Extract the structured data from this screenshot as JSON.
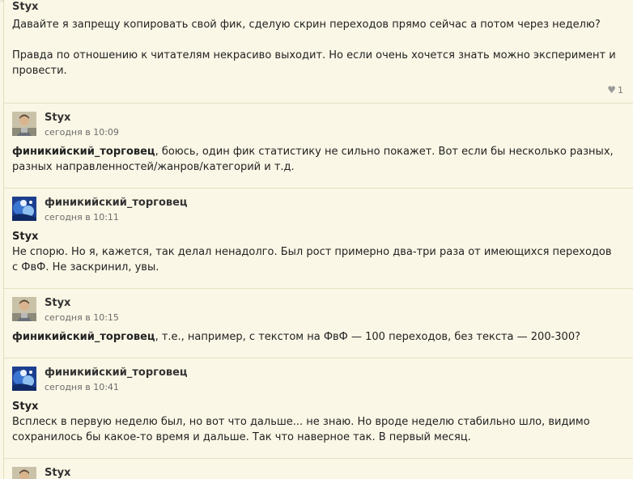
{
  "comments": [
    {
      "author": "Styx",
      "paragraphs": [
        "Давайте я запрещу копировать свой фик, сделую скрин переходов прямо сейчас а потом через неделю?",
        "Правда по отношению к читателям некрасиво выходит. Но если очень хочется знать можно эксперимент и провести."
      ],
      "likes": "1"
    },
    {
      "author": "Styx",
      "time": "сегодня в 10:09",
      "mention": "финикийский_торговец",
      "text": ", боюсь, один фик статистику не сильно покажет. Вот если бы несколько разных, разных направленностей/жанров/категорий и т.д."
    },
    {
      "author": "финикийский_торговец",
      "time": "сегодня в 10:11",
      "mention": "Styx",
      "text": "Не спорю. Но я, кажется, так делал ненадолго. Был рост примерно два-три раза от имеющихся переходов с ФвФ. Не заскринил, увы."
    },
    {
      "author": "Styx",
      "time": "сегодня в 10:15",
      "mention": "финикийский_торговец",
      "text": ", т.е., например, с текстом на ФвФ — 100 переходов, без текста — 200-300?"
    },
    {
      "author": "финикийский_торговец",
      "time": "сегодня в 10:41",
      "mention": "Styx",
      "text": "Всплеск в первую неделю был, но вот что дальше... не знаю. Но вроде неделю стабильно шло, видимо сохранилось бы какое-то время и дальше. Так что наверное так. В первый месяц."
    },
    {
      "author": "Styx"
    }
  ],
  "colors": {
    "background": "#fbf7e6",
    "border": "#e6dfc5",
    "text": "#222222",
    "muted": "#6a6a6a"
  },
  "icons": {
    "like": "heart-icon",
    "avatar_styx": "avatar-person-photo",
    "avatar_trader": "avatar-blue-abstract"
  }
}
